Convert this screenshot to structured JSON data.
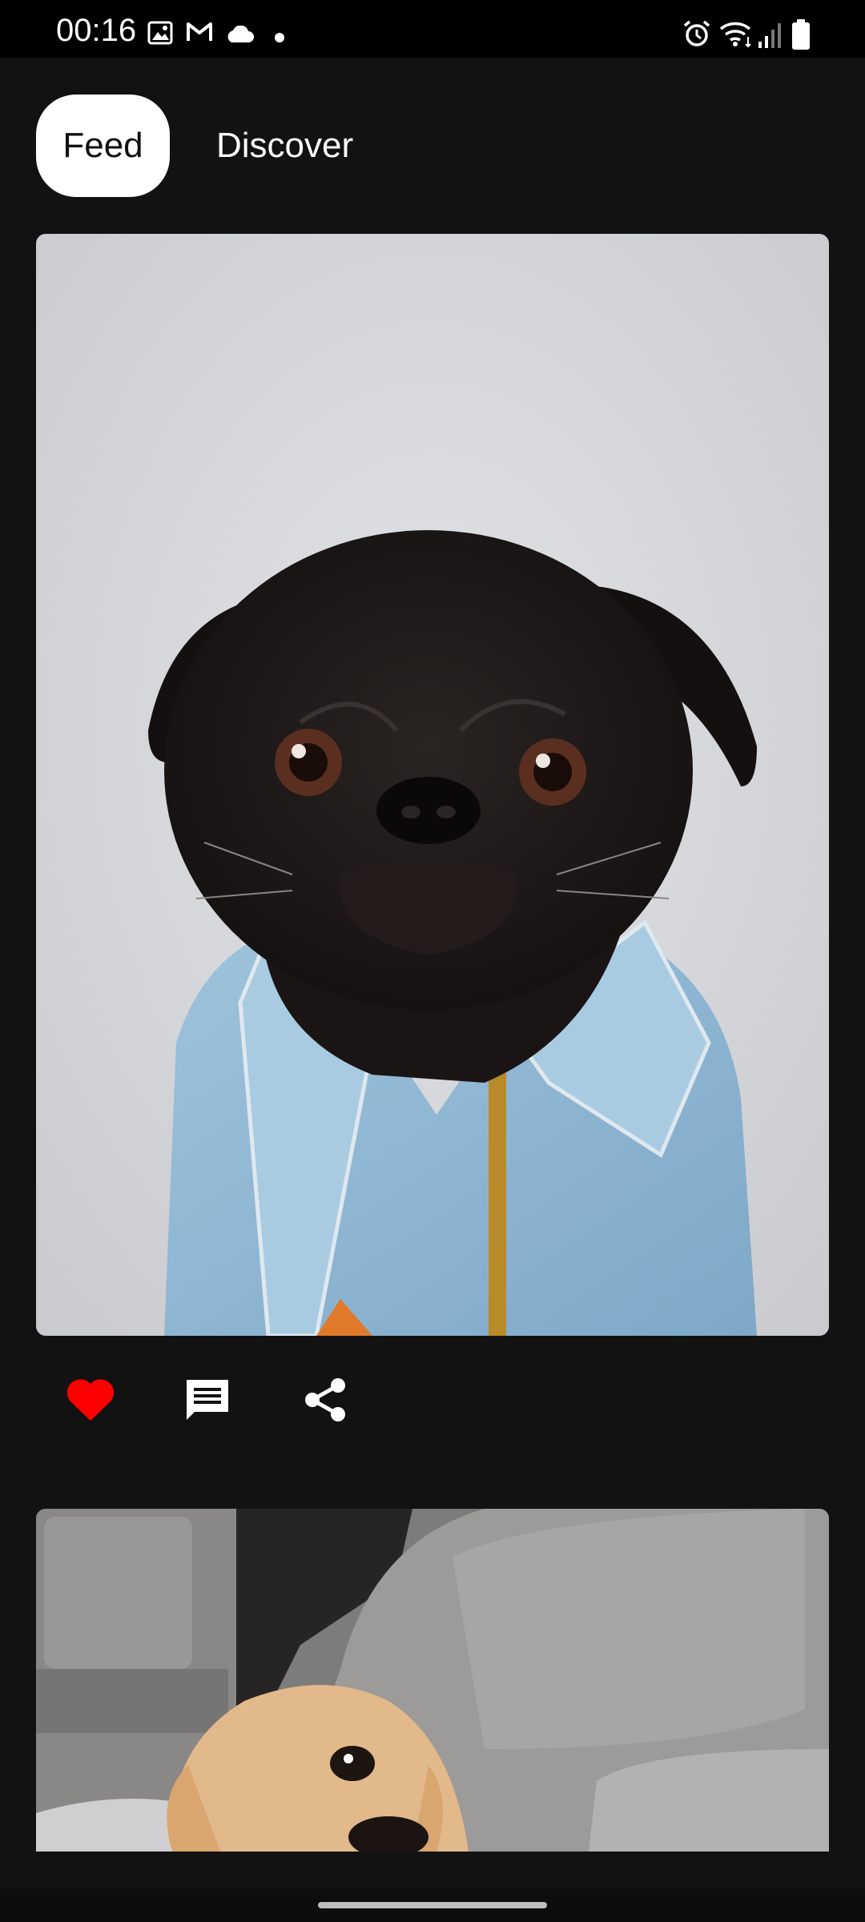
{
  "status_bar": {
    "time": "00:16",
    "left_icons": [
      "gallery-icon",
      "gmail-icon",
      "cloud-icon",
      "dot-icon"
    ],
    "right_icons": [
      "alarm-icon",
      "wifi-icon",
      "signal-icon",
      "battery-icon"
    ]
  },
  "tabs": [
    {
      "label": "Feed",
      "selected": true
    },
    {
      "label": "Discover",
      "selected": false
    }
  ],
  "feed": {
    "posts": [
      {
        "image": "pug-in-denim-jacket-photo",
        "actions": [
          {
            "icon": "heart-icon",
            "liked": true,
            "color": "#ff0000"
          },
          {
            "icon": "comment-icon"
          },
          {
            "icon": "share-icon"
          }
        ]
      },
      {
        "image": "golden-retriever-puppy-in-car-photo"
      }
    ]
  },
  "colors": {
    "background": "#121212",
    "status_bar": "#000000",
    "selected_tab_bg": "#ffffff",
    "like_red": "#ff0000"
  }
}
